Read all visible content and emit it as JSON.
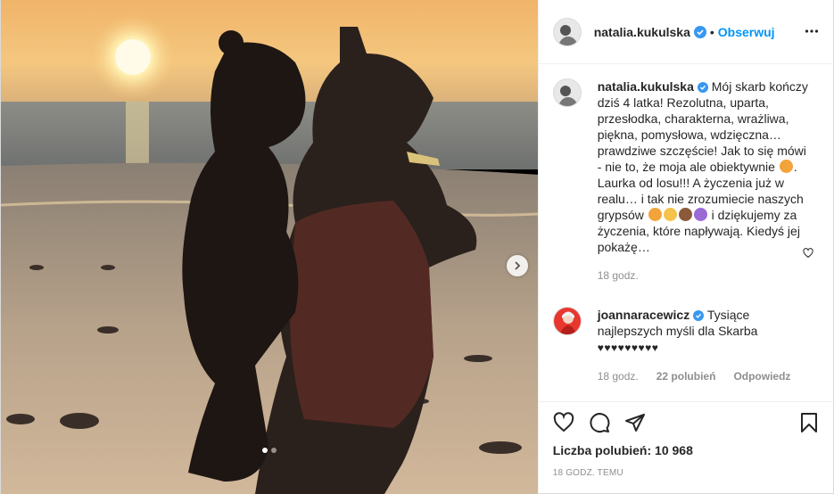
{
  "post": {
    "author": "natalia.kukulska",
    "follow_label": "Obserwuj",
    "separator": "•"
  },
  "caption": {
    "author": "natalia.kukulska",
    "text_1": " Mój skarb kończy dziś 4 latka! Rezolutna, uparta, przesłodka, charakterna, wrażliwa, piękna, pomysłowa, wdzięczna… prawdziwe szczęście! Jak to się mówi - nie to, że moja ale obiektywnie ",
    "text_2": ". Laurka od losu!!! A życzenia już w realu… i tak nie zrozumiecie naszych grypsów ",
    "text_3": " i dziękujemy za życzenia, które napływają. Kiedyś jej pokażę…",
    "time": "18 godz."
  },
  "reply": {
    "author": "joannaracewicz",
    "text": " Tysiące najlepszych myśli dla Skarba",
    "hearts": "♥♥♥♥♥♥♥♥♥",
    "time": "18 godz.",
    "likes": "22 polubień",
    "reply_label": "Odpowiedz"
  },
  "footer": {
    "likes_text": "Liczba polubień: 10 968",
    "posted": "18 godz. temu"
  },
  "colors": {
    "accent": "#0095f6",
    "verified": "#3897f0",
    "muted": "#8e8e8e"
  },
  "icons": [
    "more-icon",
    "verified-icon",
    "heart-icon",
    "comment-icon",
    "share-icon",
    "bookmark-icon",
    "chevron-right-icon"
  ]
}
